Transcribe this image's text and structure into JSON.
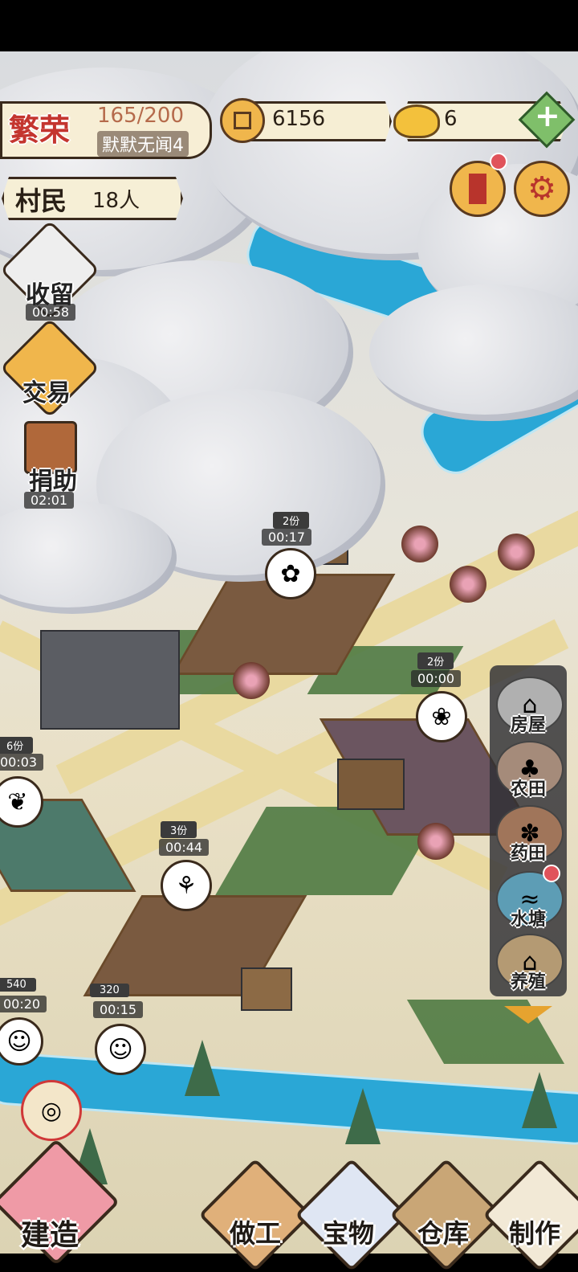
{
  "header": {
    "prosperity_label": "繁荣",
    "prosperity_value": "165/200",
    "prosperity_rank": "默默无闻4",
    "coins_value": "6156",
    "ingots_value": "6",
    "villagers_label": "村民",
    "villagers_count": "18人"
  },
  "left_actions": [
    {
      "label": "收留",
      "timer": "00:58"
    },
    {
      "label": "交易",
      "timer": ""
    },
    {
      "label": "捐助",
      "timer": "02:01"
    }
  ],
  "map_markers": {
    "top_field": {
      "portions": "2份",
      "timer": "00:17",
      "icon": "sunflower-icon"
    },
    "right_field": {
      "portions": "2份",
      "timer": "00:00",
      "icon": "lily-icon"
    },
    "left_field": {
      "portions": "6份",
      "timer": "00:03",
      "icon": "cabbage-icon"
    },
    "mid_field": {
      "portions": "3份",
      "timer": "00:44",
      "icon": "wheat-icon"
    },
    "visitor_left": {
      "price": "540",
      "timer": "00:20"
    },
    "visitor_right": {
      "price": "320",
      "timer": "00:15"
    }
  },
  "build_menu": [
    {
      "label": "房屋",
      "icon": "house-icon"
    },
    {
      "label": "农田",
      "icon": "grape-field-icon"
    },
    {
      "label": "药田",
      "icon": "herb-field-icon"
    },
    {
      "label": "水塘",
      "icon": "pond-icon"
    },
    {
      "label": "养殖",
      "icon": "barn-icon"
    }
  ],
  "bottom_bar": [
    {
      "label": "建造",
      "icon": "peony-icon"
    },
    {
      "label": "做工",
      "icon": "wood-icon"
    },
    {
      "label": "宝物",
      "icon": "vase-icon"
    },
    {
      "label": "仓库",
      "icon": "warehouse-icon"
    },
    {
      "label": "制作",
      "icon": "dish-icon"
    }
  ],
  "colors": {
    "accent_gold": "#f0b64c",
    "parchment": "#f6efd6",
    "ink": "#3a2a1c",
    "river": "#2aa7d6"
  }
}
